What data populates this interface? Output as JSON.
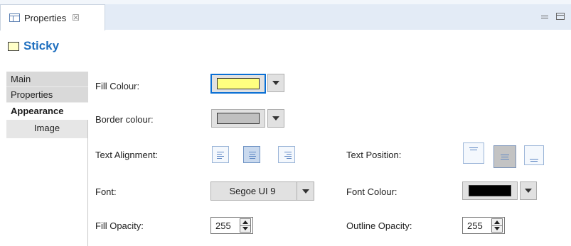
{
  "view": {
    "tab_label": "Properties",
    "close_glyph": "☒"
  },
  "header": {
    "title": "Sticky"
  },
  "sidebar": {
    "tabs": [
      {
        "label": "Main"
      },
      {
        "label": "Properties"
      },
      {
        "label": "Appearance"
      },
      {
        "label": "Image"
      }
    ],
    "active": "Appearance"
  },
  "form": {
    "fill_colour": {
      "label": "Fill Colour:",
      "color": "#ffff80"
    },
    "border_colour": {
      "label": "Border colour:",
      "color": "#c0c0c0"
    },
    "text_alignment": {
      "label": "Text Alignment:",
      "options": [
        "left-align-icon",
        "center-align-icon",
        "right-align-icon"
      ],
      "selected": "center"
    },
    "text_position": {
      "label": "Text Position:",
      "options": [
        "top-position-icon",
        "middle-position-icon",
        "bottom-position-icon"
      ],
      "selected": "middle"
    },
    "font": {
      "label": "Font:",
      "value": "Segoe UI 9"
    },
    "font_colour": {
      "label": "Font Colour:",
      "color": "#000000"
    },
    "fill_opacity": {
      "label": "Fill Opacity:",
      "value": "255"
    },
    "outline_opacity": {
      "label": "Outline Opacity:",
      "value": "255"
    }
  }
}
